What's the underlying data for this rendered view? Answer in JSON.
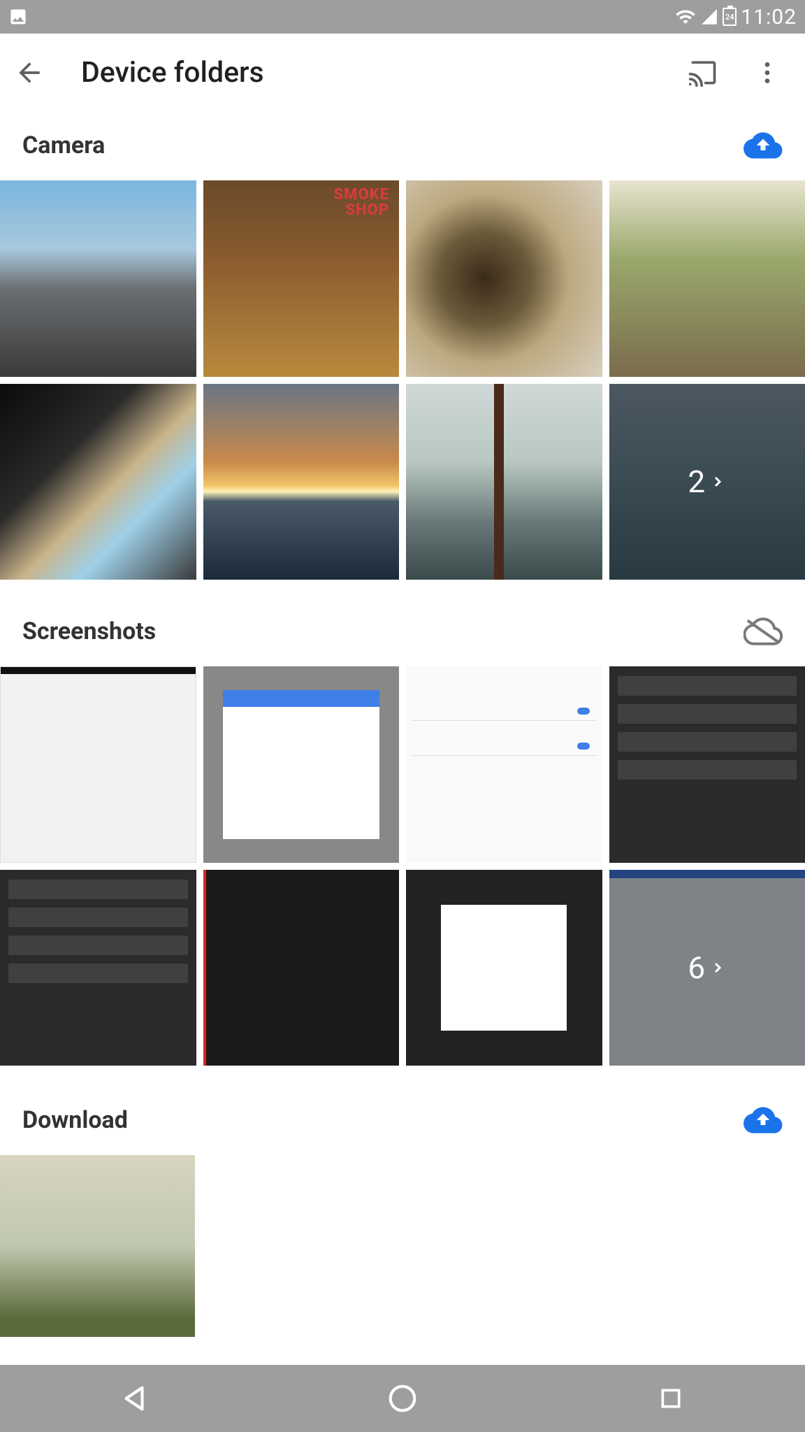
{
  "status": {
    "time": "11:02",
    "battery_level": "24"
  },
  "app_bar": {
    "title": "Device folders"
  },
  "sections": [
    {
      "title": "Camera",
      "backup": "on",
      "more_count": "2"
    },
    {
      "title": "Screenshots",
      "backup": "off",
      "more_count": "6"
    },
    {
      "title": "Download",
      "backup": "on"
    }
  ]
}
